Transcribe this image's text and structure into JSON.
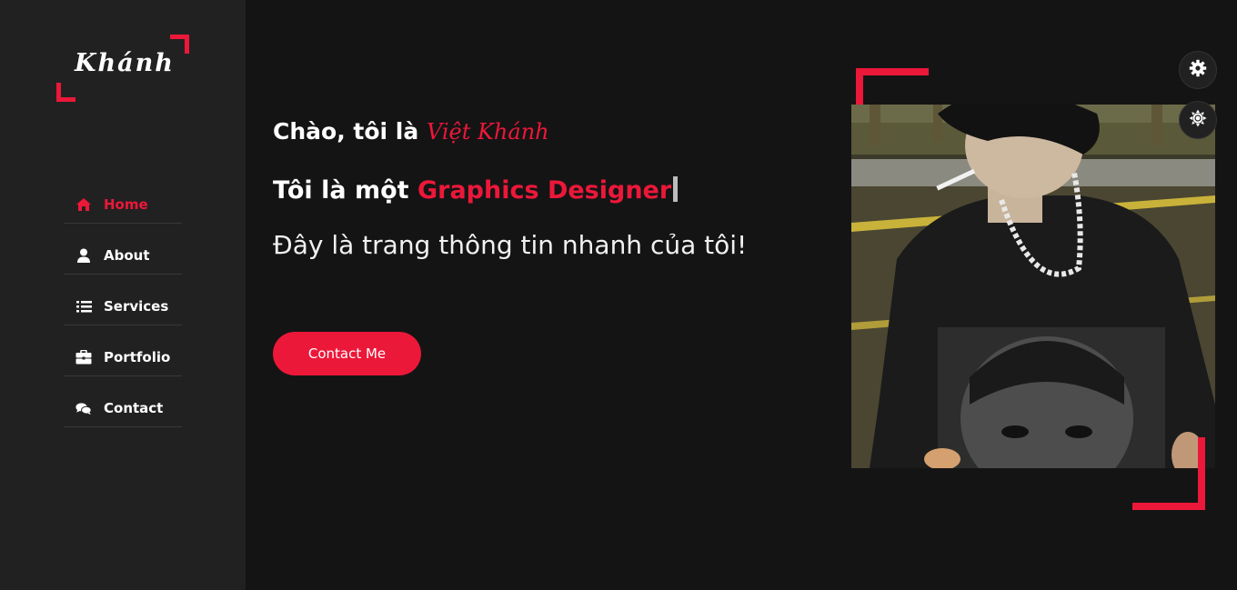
{
  "sidebar": {
    "logo_text": "Khánh",
    "items": [
      {
        "label": "Home",
        "icon": "home-icon",
        "active": true
      },
      {
        "label": "About",
        "icon": "user-icon",
        "active": false
      },
      {
        "label": "Services",
        "icon": "list-icon",
        "active": false
      },
      {
        "label": "Portfolio",
        "icon": "briefcase-icon",
        "active": false
      },
      {
        "label": "Contact",
        "icon": "comments-icon",
        "active": false
      }
    ]
  },
  "hero": {
    "greeting_prefix": "Chào, tôi là ",
    "name": "Việt Khánh",
    "profession_prefix": "Tôi là một ",
    "profession": "Graphics Designer",
    "intro": "Đây là trang thông tin nhanh của tôi!",
    "contact_button": "Contact Me"
  },
  "controls": {
    "settings_icon": "gear-icon",
    "theme_icon": "sun-icon"
  },
  "colors": {
    "accent": "#ec1839",
    "sidebar_bg": "#222122",
    "page_bg": "#151415"
  }
}
